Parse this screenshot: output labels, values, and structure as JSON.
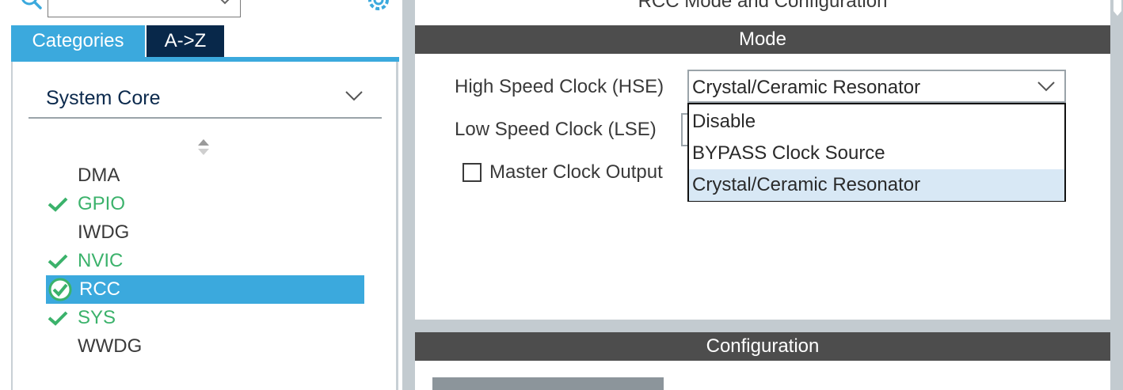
{
  "left": {
    "search": {
      "value": "",
      "icons": [
        "search-icon",
        "chevron-down-icon",
        "gear-icon"
      ]
    },
    "tabs": [
      {
        "label": "Categories",
        "active": true
      },
      {
        "label": "A->Z",
        "active": false
      }
    ],
    "category": {
      "label": "System Core"
    },
    "tree": [
      {
        "label": "DMA",
        "status": "none"
      },
      {
        "label": "GPIO",
        "status": "ok"
      },
      {
        "label": "IWDG",
        "status": "none"
      },
      {
        "label": "NVIC",
        "status": "ok"
      },
      {
        "label": "RCC",
        "status": "ok",
        "selected": true
      },
      {
        "label": "SYS",
        "status": "ok"
      },
      {
        "label": "WWDG",
        "status": "none"
      }
    ]
  },
  "right": {
    "title": "RCC Mode and Configuration",
    "mode": {
      "header": "Mode",
      "hse": {
        "label": "High Speed Clock (HSE)",
        "value": "Crystal/Ceramic Resonator"
      },
      "lse": {
        "label": "Low Speed Clock (LSE)",
        "value": ""
      },
      "mco": {
        "label": "Master Clock Output",
        "checked": false
      },
      "dropdown": {
        "options": [
          "Disable",
          "BYPASS Clock Source",
          "Crystal/Ceramic Resonator"
        ],
        "highlighted_index": 2
      }
    },
    "configuration": {
      "header": "Configuration"
    }
  },
  "colors": {
    "accent": "#3ba9dd",
    "dark_tab": "#08284a",
    "ok_green": "#3bb26b",
    "section_bar": "#4d4d4d",
    "highlight": "#d8e8f5"
  }
}
